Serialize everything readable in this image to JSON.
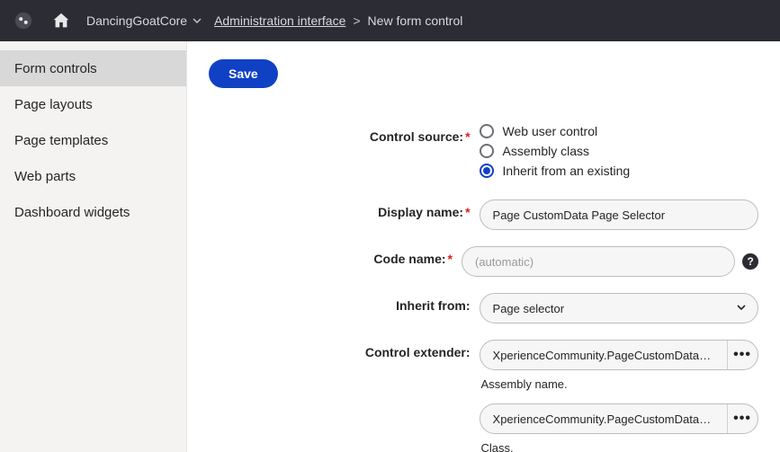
{
  "topbar": {
    "site_name": "DancingGoatCore",
    "breadcrumb_root": "Administration interface",
    "breadcrumb_sep": ">",
    "breadcrumb_current": "New form control"
  },
  "sidebar": {
    "items": [
      {
        "label": "Form controls",
        "active": true
      },
      {
        "label": "Page layouts",
        "active": false
      },
      {
        "label": "Page templates",
        "active": false
      },
      {
        "label": "Web parts",
        "active": false
      },
      {
        "label": "Dashboard widgets",
        "active": false
      }
    ]
  },
  "toolbar": {
    "save_label": "Save"
  },
  "form": {
    "control_source": {
      "label": "Control source:",
      "options": [
        {
          "label": "Web user control",
          "selected": false
        },
        {
          "label": "Assembly class",
          "selected": false
        },
        {
          "label": "Inherit from an existing",
          "selected": true
        }
      ]
    },
    "display_name": {
      "label": "Display name:",
      "value": "Page CustomData Page Selector"
    },
    "code_name": {
      "label": "Code name:",
      "placeholder": "(automatic)",
      "value": "",
      "help": "?"
    },
    "inherit_from": {
      "label": "Inherit from:",
      "value": "Page selector"
    },
    "control_extender": {
      "label": "Control extender:",
      "assembly_value": "XperienceCommunity.PageCustomDataCon…",
      "assembly_help": "Assembly name.",
      "class_value": "XperienceCommunity.PageCustomDataCon…",
      "class_help": "Class.",
      "more": "•••"
    },
    "required_mark": "*"
  }
}
